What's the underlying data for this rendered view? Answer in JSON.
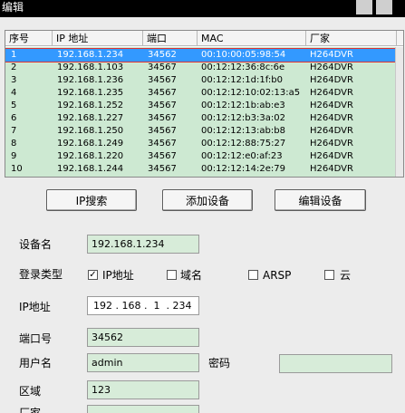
{
  "window": {
    "title": "编辑"
  },
  "table": {
    "columns": [
      "序号",
      "IP 地址",
      "端口",
      "MAC",
      "厂家"
    ],
    "rows": [
      {
        "no": "1",
        "ip": "192.168.1.234",
        "port": "34562",
        "mac": "00:10:00:05:98:54",
        "vendor": "H264DVR"
      },
      {
        "no": "2",
        "ip": "192.168.1.103",
        "port": "34567",
        "mac": "00:12:12:36:8c:6e",
        "vendor": "H264DVR"
      },
      {
        "no": "3",
        "ip": "192.168.1.236",
        "port": "34567",
        "mac": "00:12:12:1d:1f:b0",
        "vendor": "H264DVR"
      },
      {
        "no": "4",
        "ip": "192.168.1.235",
        "port": "34567",
        "mac": "00:12:12:10:02:13:a5",
        "vendor": "H264DVR"
      },
      {
        "no": "5",
        "ip": "192.168.1.252",
        "port": "34567",
        "mac": "00:12:12:1b:ab:e3",
        "vendor": "H264DVR"
      },
      {
        "no": "6",
        "ip": "192.168.1.227",
        "port": "34567",
        "mac": "00:12:12:b3:3a:02",
        "vendor": "H264DVR"
      },
      {
        "no": "7",
        "ip": "192.168.1.250",
        "port": "34567",
        "mac": "00:12:12:13:ab:b8",
        "vendor": "H264DVR"
      },
      {
        "no": "8",
        "ip": "192.168.1.249",
        "port": "34567",
        "mac": "00:12:12:88:75:27",
        "vendor": "H264DVR"
      },
      {
        "no": "9",
        "ip": "192.168.1.220",
        "port": "34567",
        "mac": "00:12:12:e0:af:23",
        "vendor": "H264DVR"
      },
      {
        "no": "10",
        "ip": "192.168.1.244",
        "port": "34567",
        "mac": "00:12:12:14:2e:79",
        "vendor": "H264DVR"
      }
    ]
  },
  "buttons": {
    "ip_search": "IP搜索",
    "add_device": "添加设备",
    "edit_device": "编辑设备"
  },
  "form": {
    "device_name_label": "设备名",
    "device_name_value": "192.168.1.234",
    "login_type_label": "登录类型",
    "opt_ip": "IP地址",
    "opt_domain": "域名",
    "opt_arsp": "ARSP",
    "opt_cloud": "云",
    "ip_label": "IP地址",
    "ip_value": "192 . 168 .  1  . 234",
    "port_label": "端口号",
    "port_value": "34562",
    "user_label": "用户名",
    "user_value": "admin",
    "password_label": "密码",
    "password_value": "",
    "region_label": "区域",
    "region_value": "123",
    "vendor_label": "厂家"
  }
}
